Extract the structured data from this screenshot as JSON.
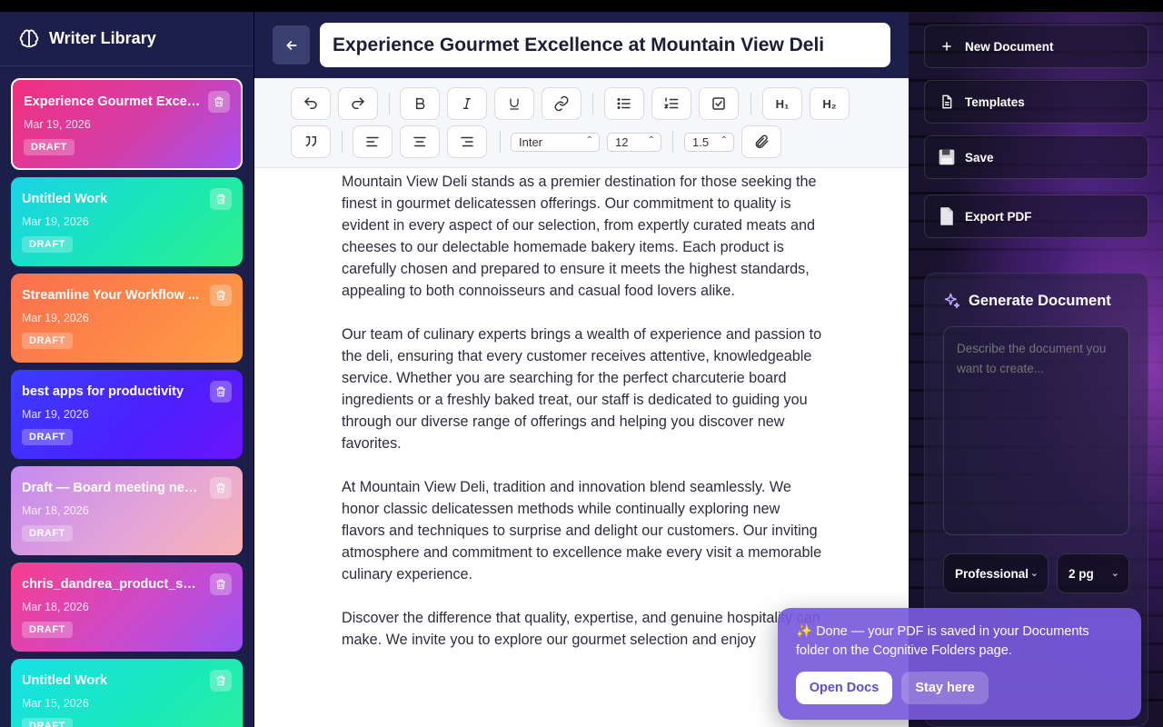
{
  "sidebar": {
    "title": "Writer Library",
    "documents": [
      {
        "title": "Experience Gourmet Excell...",
        "date": "Mar 19, 2026",
        "badge": "DRAFT"
      },
      {
        "title": "Untitled Work",
        "date": "Mar 19, 2026",
        "badge": "DRAFT"
      },
      {
        "title": "Streamline Your Workflow ...",
        "date": "Mar 19, 2026",
        "badge": "DRAFT"
      },
      {
        "title": "best apps for productivity",
        "date": "Mar 19, 2026",
        "badge": "DRAFT"
      },
      {
        "title": "Draft — Board meeting next...",
        "date": "Mar 18, 2026",
        "badge": "DRAFT"
      },
      {
        "title": "chris_dandrea_product_su...",
        "date": "Mar 18, 2026",
        "badge": "DRAFT"
      },
      {
        "title": "Untitled Work",
        "date": "Mar 15, 2026",
        "badge": "DRAFT"
      }
    ]
  },
  "editor": {
    "title": "Experience Gourmet Excellence at Mountain View Deli",
    "toolbar": {
      "h1": "H₁",
      "h2": "H₂",
      "font": "Inter",
      "size": "12",
      "line_height": "1.5"
    },
    "paragraphs": [
      "Mountain View Deli stands as a premier destination for those seeking the finest in gourmet delicatessen offerings. Our commitment to quality is evident in every aspect of our selection, from expertly curated meats and cheeses to our delectable homemade bakery items. Each product is carefully chosen and prepared to ensure it meets the highest standards, appealing to both connoisseurs and casual food lovers alike.",
      "Our team of culinary experts brings a wealth of experience and passion to the deli, ensuring that every customer receives attentive, knowledgeable service. Whether you are searching for the perfect charcuterie board ingredients or a freshly baked treat, our staff is dedicated to guiding you through our diverse range of offerings and helping you discover new favorites.",
      "At Mountain View Deli, tradition and innovation blend seamlessly. We honor classic delicatessen methods while continually exploring new flavors and techniques to surprise and delight our customers. Our inviting atmosphere and commitment to excellence make every visit a memorable culinary experience.",
      "Discover the difference that quality, expertise, and genuine hospitality can make. We invite you to explore our gourmet selection and enjoy"
    ]
  },
  "right_panel": {
    "new_document": "New Document",
    "templates": "Templates",
    "save": "Save",
    "export_pdf": "Export PDF",
    "generate": {
      "title": "Generate Document",
      "placeholder": "Describe the document you want to create...",
      "style": "Professional",
      "length": "2 pg"
    }
  },
  "toast": {
    "message": "✨ Done — your PDF is saved in your Documents folder on the Cognitive Folders page.",
    "open_docs": "Open Docs",
    "stay_here": "Stay here"
  }
}
